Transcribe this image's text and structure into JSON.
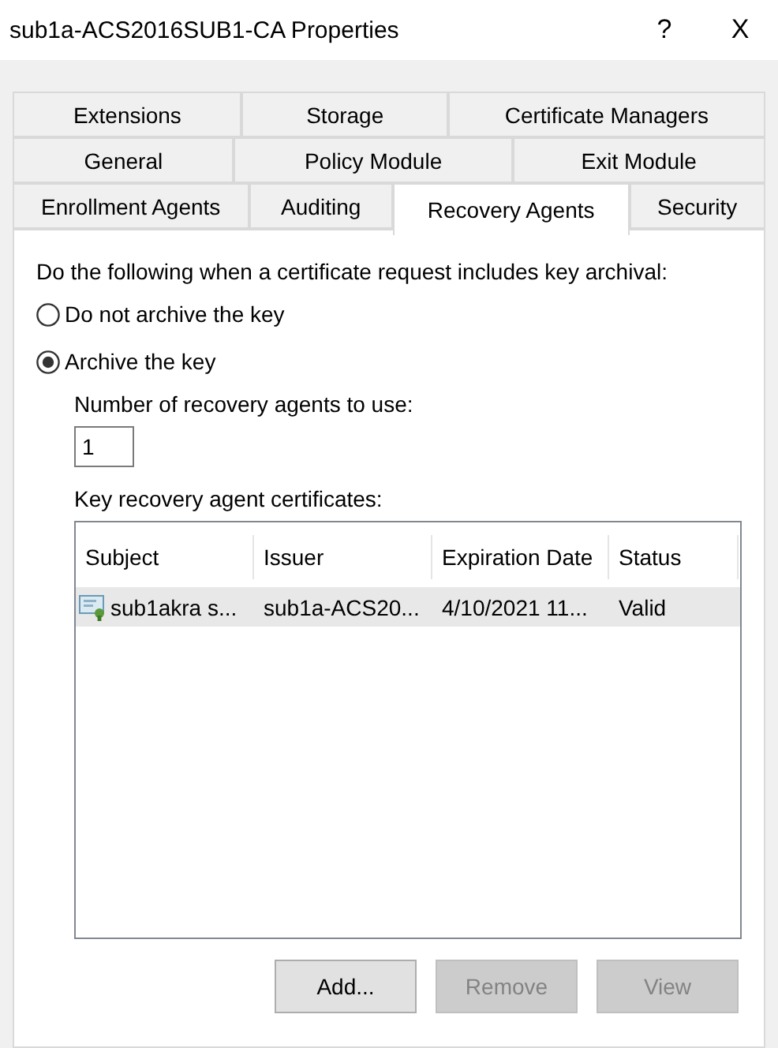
{
  "window": {
    "title": "sub1a-ACS2016SUB1-CA Properties",
    "help": "?",
    "close": "X"
  },
  "tab_rows": [
    [
      {
        "label": "Extensions",
        "selected": false
      },
      {
        "label": "Storage",
        "selected": false
      },
      {
        "label": "Certificate Managers",
        "selected": false
      }
    ],
    [
      {
        "label": "General",
        "selected": false
      },
      {
        "label": "Policy Module",
        "selected": false
      },
      {
        "label": "Exit Module",
        "selected": false
      }
    ],
    [
      {
        "label": "Enrollment Agents",
        "selected": false
      },
      {
        "label": "Auditing",
        "selected": false
      },
      {
        "label": "Recovery Agents",
        "selected": true
      },
      {
        "label": "Security",
        "selected": false
      }
    ]
  ],
  "prompt": "Do the following when a certificate request includes key archival:",
  "options": [
    {
      "label": "Do not archive the key",
      "selected": false
    },
    {
      "label": "Archive the key",
      "selected": true
    }
  ],
  "agents_count": {
    "label": "Number of recovery agents to use:",
    "value": "1"
  },
  "certificates": {
    "label": "Key recovery agent certificates:",
    "columns": [
      "Subject",
      "Issuer",
      "Expiration Date",
      "Status"
    ],
    "rows": [
      {
        "cells": [
          "sub1akra s...",
          "sub1a-ACS20...",
          "4/10/2021 11...",
          "Valid"
        ],
        "selected": true
      }
    ]
  },
  "buttons": [
    {
      "label": "Add...",
      "disabled": false
    },
    {
      "label": "Remove",
      "disabled": true
    },
    {
      "label": "View",
      "disabled": true
    }
  ]
}
